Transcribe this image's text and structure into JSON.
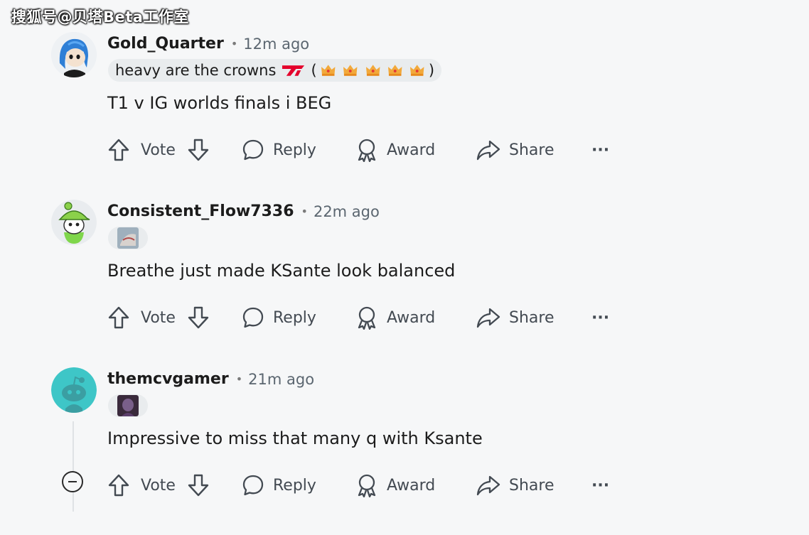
{
  "watermark": "搜狐号@贝塔Beta工作室",
  "actions": {
    "vote": "Vote",
    "reply": "Reply",
    "award": "Award",
    "share": "Share",
    "more": "···"
  },
  "comments": [
    {
      "username": "Gold_Quarter",
      "time": "12m ago",
      "flair_text": "heavy are the crowns",
      "flair_open": "(",
      "flair_close": ")",
      "body": "T1 v IG worlds finals i BEG",
      "avatar_icon": "snoo-blue-hair-avatar"
    },
    {
      "username": "Consistent_Flow7336",
      "time": "22m ago",
      "body": "Breathe just made KSante look balanced",
      "avatar_icon": "snoo-green-hat-avatar"
    },
    {
      "username": "themcvgamer",
      "time": "21m ago",
      "body": "Impressive to miss that many q with Ksante",
      "avatar_icon": "snoo-default-teal-avatar"
    }
  ],
  "colors": {
    "background": "#f6f7f8",
    "flair_bg": "#e9ecee",
    "action_text": "#434a52",
    "t1_red": "#e4002b",
    "default_avatar": "#3ec6c7"
  }
}
